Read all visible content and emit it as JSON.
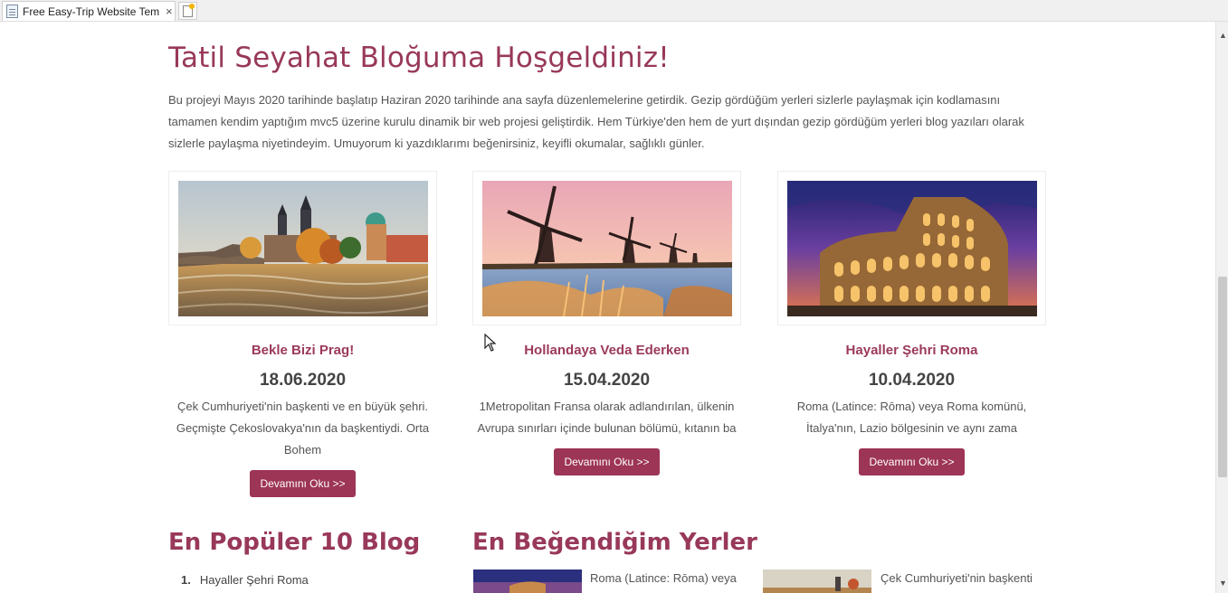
{
  "browser": {
    "tab_title": "Free Easy-Trip Website Tem...",
    "tab_close": "×"
  },
  "hero": {
    "title": "Tatil Seyahat Bloğuma Hoşgeldiniz!",
    "intro": "Bu projeyi Mayıs 2020 tarihinde başlatıp Haziran 2020 tarihinde ana sayfa düzenlemelerine getirdik. Gezip gördüğüm yerleri sizlerle paylaşmak için kodlamasını tamamen kendim yaptığım mvc5 üzerine kurulu dinamik bir web projesi geliştirdik. Hem Türkiye'den hem de yurt dışından gezip gördüğüm yerleri blog yazıları olarak sizlerle paylaşma niyetindeyim. Umuyorum ki yazdıklarımı beğenirsiniz, keyifli okumalar, sağlıklı günler."
  },
  "cards": [
    {
      "title": "Bekle Bizi Prag!",
      "date": "18.06.2020",
      "desc": "Çek Cumhuriyeti'nin başkenti ve en büyük şehri. Geçmişte Çekoslovakya'nın da başkentiydi. Orta Bohem",
      "button": "Devamını Oku >>"
    },
    {
      "title": "Hollandaya Veda Ederken",
      "date": "15.04.2020",
      "desc": "1Metropolitan Fransa olarak adlandırılan, ülkenin Avrupa sınırları içinde bulunan bölümü, kıtanın ba",
      "button": "Devamını Oku >>"
    },
    {
      "title": "Hayaller Şehri Roma",
      "date": "10.04.2020",
      "desc": "Roma (Latince: Rōma) veya Roma komünü, İtalya'nın, Lazio bölgesinin ve aynı zama",
      "button": "Devamını Oku >>"
    }
  ],
  "popular": {
    "title": "En Popüler 10 Blog",
    "items": [
      {
        "num": "1.",
        "label": "Hayaller Şehri Roma"
      }
    ]
  },
  "favorites": {
    "title": "En Beğendiğim Yerler",
    "items": [
      {
        "text": "Roma (Latince: Rōma) veya"
      },
      {
        "text": "Çek Cumhuriyeti'nin başkenti"
      }
    ]
  },
  "colors": {
    "accent": "#98385a",
    "button": "#9d3556"
  }
}
